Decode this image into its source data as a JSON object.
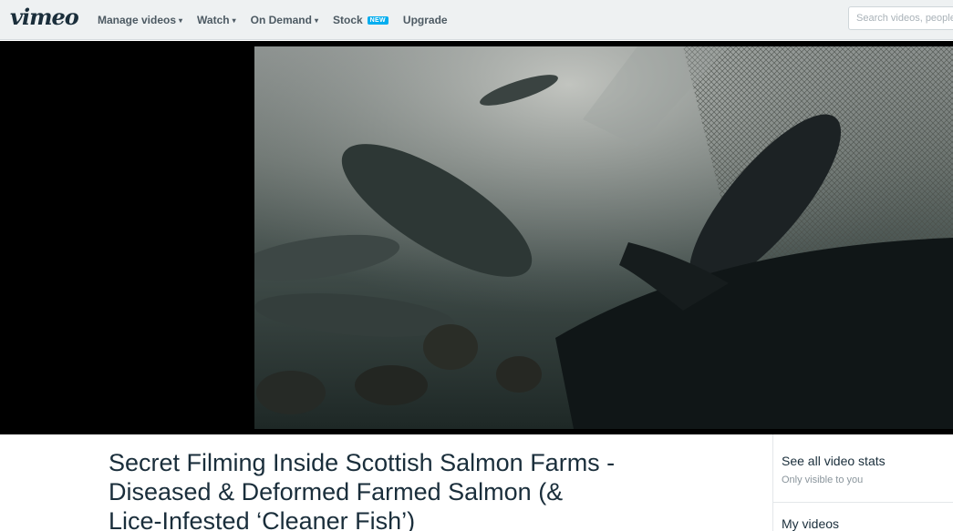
{
  "header": {
    "logo": "vimeo",
    "nav": [
      {
        "label": "Manage videos",
        "dropdown": true
      },
      {
        "label": "Watch",
        "dropdown": true
      },
      {
        "label": "On Demand",
        "dropdown": true
      },
      {
        "label": "Stock",
        "badge": "NEW"
      },
      {
        "label": "Upgrade"
      }
    ],
    "search_placeholder": "Search videos, people"
  },
  "video": {
    "title": "Secret Filming Inside Scottish Salmon Farms - Diseased & Deformed Farmed Salmon (& Lice-Infested ‘Cleaner Fish’)"
  },
  "sidebar": {
    "stats_link": "See all video stats",
    "stats_note": "Only visible to you",
    "my_videos": "My videos"
  },
  "colors": {
    "nav_bg": "#eef1f2",
    "text_dark": "#1a2e3b",
    "badge_bg": "#00adef"
  }
}
